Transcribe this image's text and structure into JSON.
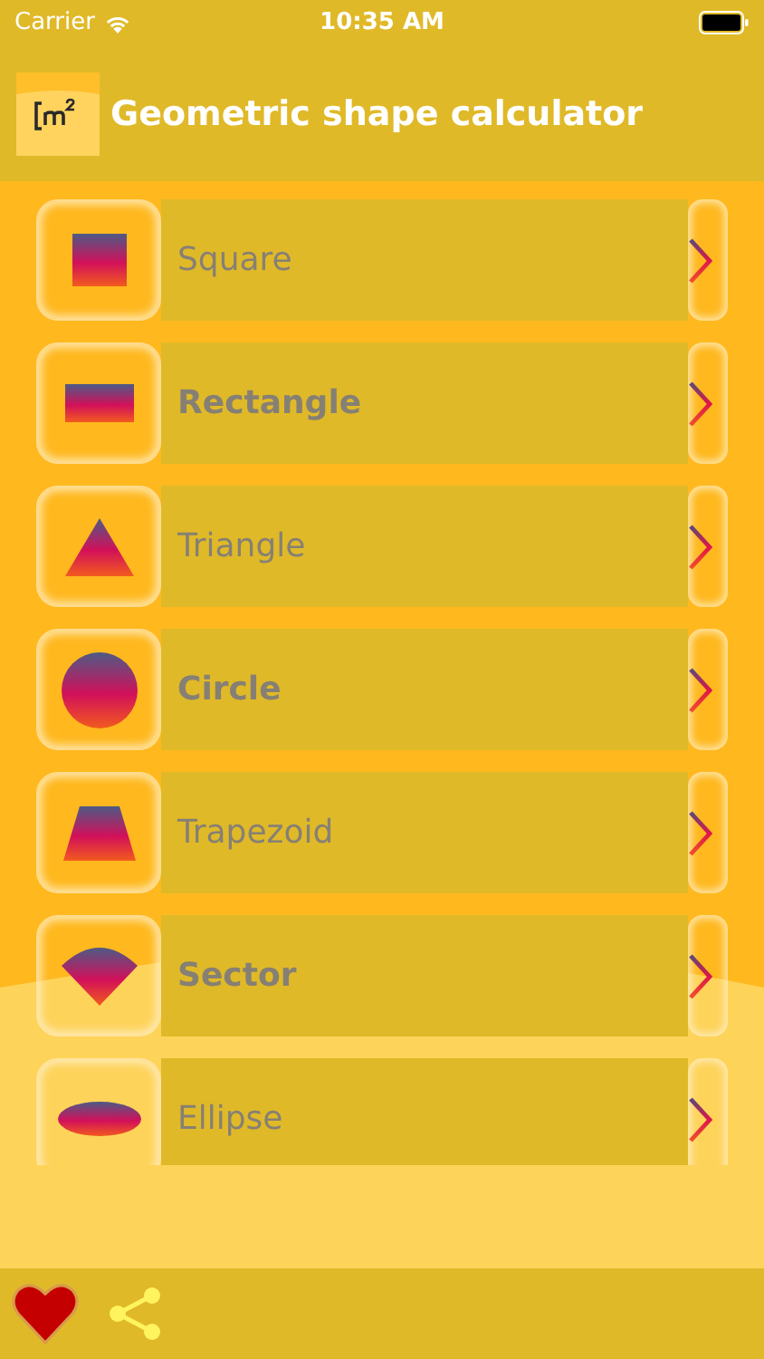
{
  "status_bar": {
    "carrier": "Carrier",
    "time": "10:35 AM"
  },
  "header": {
    "title": "Geometric shape calculator"
  },
  "shapes": [
    {
      "label": "Square",
      "kind": "square",
      "bold": false
    },
    {
      "label": "Rectangle",
      "kind": "rectangle",
      "bold": true
    },
    {
      "label": "Triangle",
      "kind": "triangle",
      "bold": false
    },
    {
      "label": "Circle",
      "kind": "circle",
      "bold": true
    },
    {
      "label": "Trapezoid",
      "kind": "trapezoid",
      "bold": false
    },
    {
      "label": "Sector",
      "kind": "sector",
      "bold": true
    },
    {
      "label": "Ellipse",
      "kind": "ellipse",
      "bold": false
    }
  ]
}
